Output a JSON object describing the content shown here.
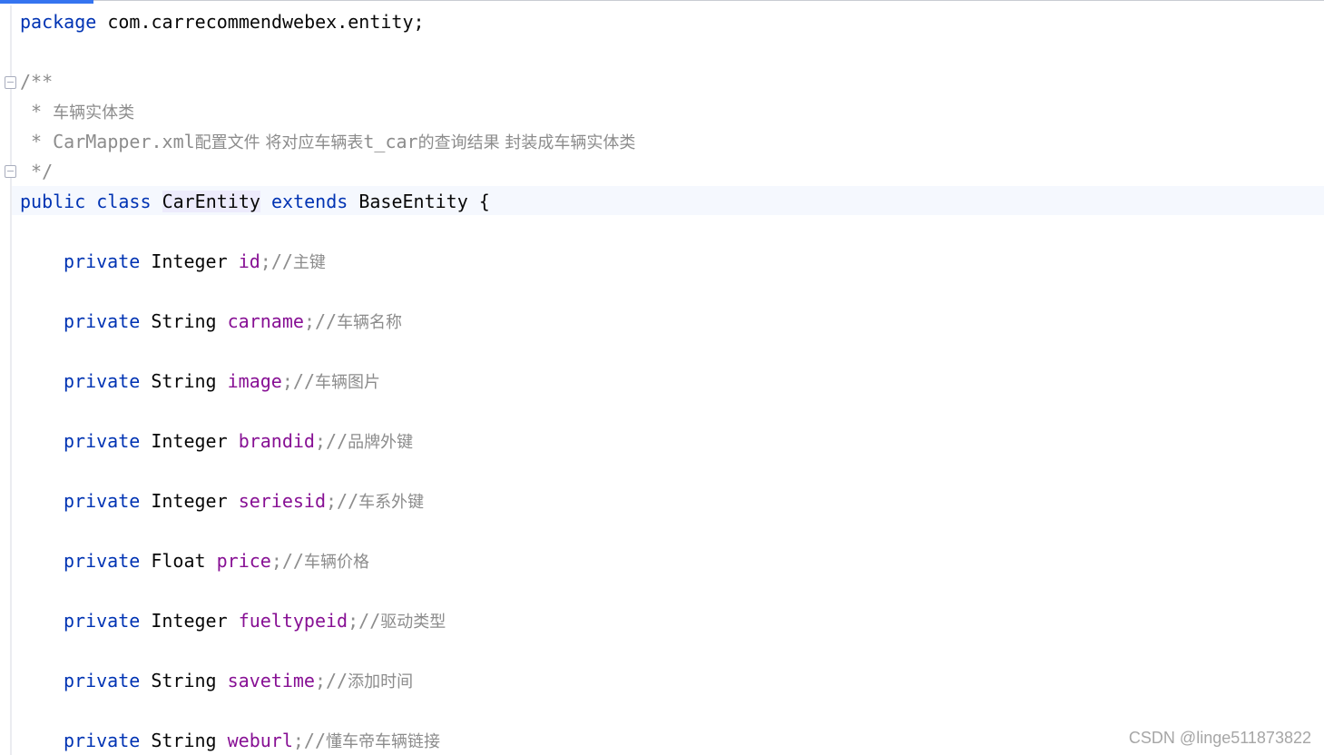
{
  "code": {
    "package_line": {
      "keyword": "package",
      "name": " com.carrecommendwebex.entity;"
    },
    "javadoc": {
      "open": "/**",
      "line1_prefix": " * ",
      "line1_text": "车辆实体类",
      "line2_prefix": " * CarMapper.xml",
      "line2_text": "配置文件 将对应车辆表",
      "line2_mid": "t_car",
      "line2_tail": "的查询结果 封装成车辆实体类",
      "close": " */"
    },
    "class_decl": {
      "kw_public": "public",
      "kw_class": "class",
      "class_name": "CarEntity",
      "kw_extends": "extends",
      "parent": "BaseEntity",
      "brace": "{"
    },
    "fields": [
      {
        "modifier": "private",
        "type": "Integer",
        "name": "id",
        "punct": ";//",
        "comment": "主键"
      },
      {
        "modifier": "private",
        "type": "String",
        "name": "carname",
        "punct": ";//",
        "comment": "车辆名称"
      },
      {
        "modifier": "private",
        "type": "String",
        "name": "image",
        "punct": ";//",
        "comment": "车辆图片"
      },
      {
        "modifier": "private",
        "type": "Integer",
        "name": "brandid",
        "punct": ";//",
        "comment": "品牌外键"
      },
      {
        "modifier": "private",
        "type": "Integer",
        "name": "seriesid",
        "punct": ";//",
        "comment": "车系外键"
      },
      {
        "modifier": "private",
        "type": "Float",
        "name": "price",
        "punct": ";//",
        "comment": "车辆价格"
      },
      {
        "modifier": "private",
        "type": "Integer",
        "name": "fueltypeid",
        "punct": ";//",
        "comment": "驱动类型"
      },
      {
        "modifier": "private",
        "type": "String",
        "name": "savetime",
        "punct": ";//",
        "comment": "添加时间"
      },
      {
        "modifier": "private",
        "type": "String",
        "name": "weburl",
        "punct": ";//",
        "comment": "懂车帝车辆链接"
      }
    ]
  },
  "watermark": "CSDN @linge511873822",
  "colors": {
    "keyword": "#0033b3",
    "field": "#871094",
    "comment": "#8c8c8c",
    "text": "#080808",
    "current_line": "#f5f8fe"
  }
}
